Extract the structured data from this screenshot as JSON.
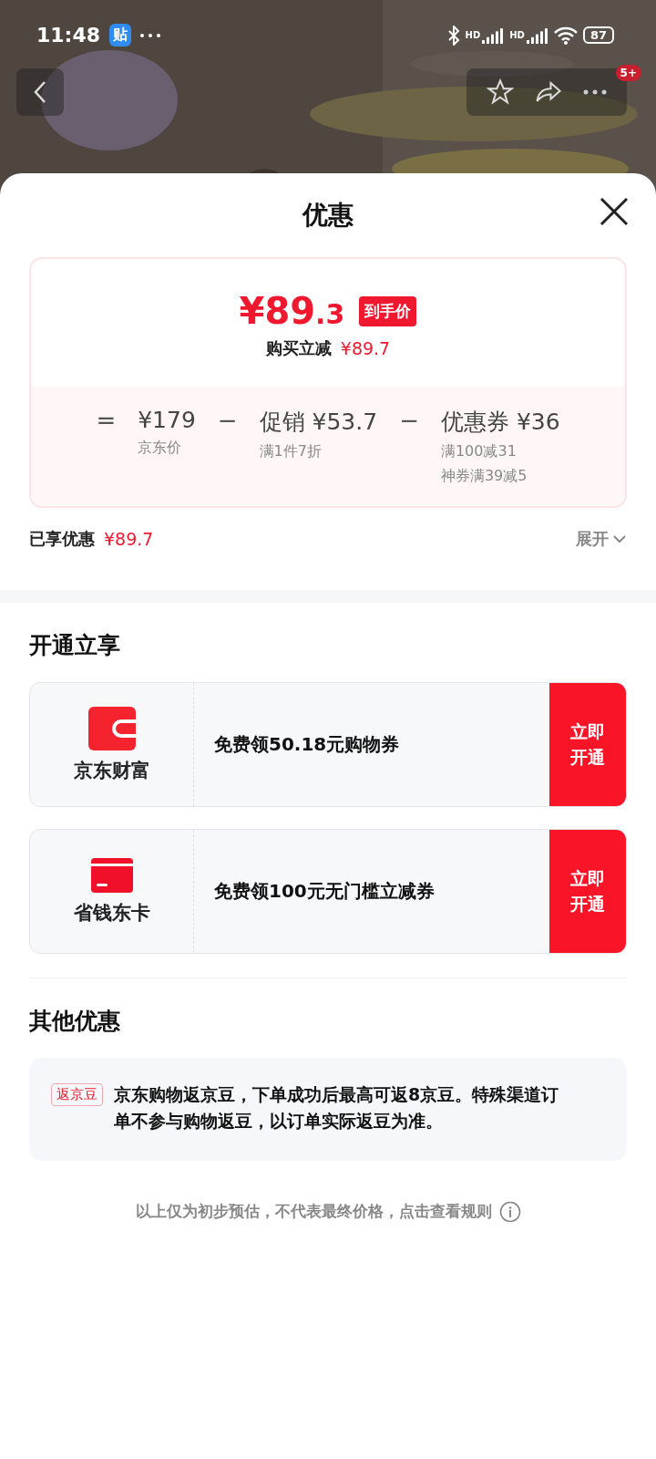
{
  "status_bar": {
    "time": "11:48",
    "app_badge": "贴",
    "network_labels": [
      "HD",
      "HD"
    ],
    "battery": "87"
  },
  "header_image": {
    "kind": "picture",
    "cart_badge": "5+"
  },
  "sheet": {
    "title": "优惠"
  },
  "price_card": {
    "price_symbol": "¥",
    "price_main": "89",
    "price_decimal": ".3",
    "price_tag": "到手价",
    "reduce_label": "购买立减",
    "reduce_amount": "¥89.7",
    "terms": [
      {
        "operator": "=",
        "amount": "¥179",
        "notes": [
          "京东价"
        ]
      },
      {
        "operator": "−",
        "amount": "促销 ¥53.7",
        "notes": [
          "满1件7折"
        ]
      },
      {
        "operator": "−",
        "amount": "优惠券 ¥36",
        "notes": [
          "满100减31",
          "神券满39减5"
        ]
      }
    ]
  },
  "enjoyed": {
    "label": "已享优惠",
    "amount": "¥89.7",
    "expand": "展开"
  },
  "open_section": {
    "title": "开通立享",
    "offers": [
      {
        "kind": "wallet",
        "name": "京东财富",
        "text": "免费领50.18元购物券",
        "button": "立即开通"
      },
      {
        "kind": "card",
        "name": "省钱东卡",
        "text": "免费领100元无门槛立减券",
        "button": "立即开通"
      }
    ]
  },
  "other_section": {
    "title": "其他优惠",
    "items": [
      {
        "tag": "返京豆",
        "text": "京东购物返京豆，下单成功后最高可返8京豆。特殊渠道订单不参与购物返豆，以订单实际返豆为准。"
      }
    ]
  },
  "footer": {
    "text": "以上仅为初步预估，不代表最终价格，点击查看规则"
  }
}
